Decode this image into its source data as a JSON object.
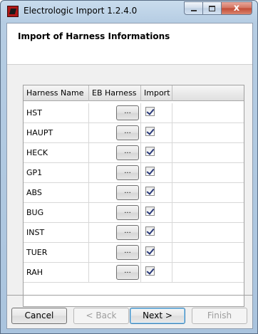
{
  "window": {
    "title": "Electrologic Import 1.2.4.0",
    "min_label": "",
    "max_label": "",
    "close_label": "x"
  },
  "header": {
    "title": "Import of Harness Informations"
  },
  "grid": {
    "columns": [
      "Harness Name",
      "EB Harness",
      "Import"
    ],
    "browse_label": "...",
    "rows": [
      {
        "name": "HST",
        "import": true
      },
      {
        "name": "HAUPT",
        "import": true
      },
      {
        "name": "HECK",
        "import": true
      },
      {
        "name": "GP1",
        "import": true
      },
      {
        "name": "ABS",
        "import": true
      },
      {
        "name": "BUG",
        "import": true
      },
      {
        "name": "INST",
        "import": true
      },
      {
        "name": "TUER",
        "import": true
      },
      {
        "name": "RAH",
        "import": true
      }
    ]
  },
  "footer": {
    "cancel_label": "Cancel",
    "back_label": "< Back",
    "next_label": "Next >",
    "finish_label": "Finish"
  }
}
